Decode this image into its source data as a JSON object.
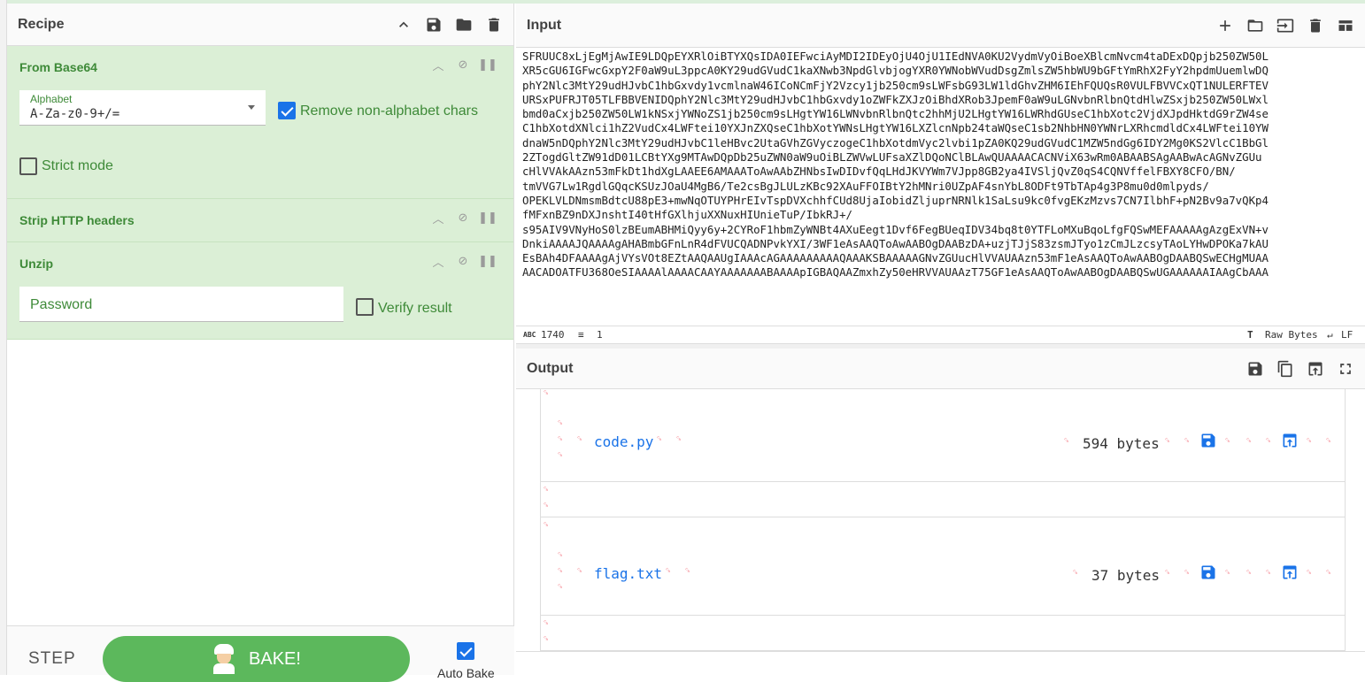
{
  "recipe": {
    "title": "Recipe",
    "operations": [
      {
        "name": "From Base64",
        "alphabet_label": "Alphabet",
        "alphabet_value": "A-Za-z0-9+/=",
        "remove_label": "Remove non-alphabet chars",
        "remove_checked": true,
        "strict_label": "Strict mode",
        "strict_checked": false
      },
      {
        "name": "Strip HTTP headers"
      },
      {
        "name": "Unzip",
        "password_placeholder": "Password",
        "verify_label": "Verify result",
        "verify_checked": false
      }
    ],
    "step_label": "STEP",
    "bake_label": "BAKE!",
    "autobake_label": "Auto Bake",
    "autobake_checked": true
  },
  "input": {
    "title": "Input",
    "lines": [
      "SFRUUC8xLjEgMjAwIE9LDQpEYXRlOiBTYXQsIDA0IEFwciAyMDI2IDEyOjU4OjU1IEdNVA0KU2VydmVyOiBoeXBlcmNvcm4taDExDQpjb250ZW50L",
      "XR5cGU6IGFwcGxpY2F0aW9uL3ppcA0KY29udGVudC1kaXNwb3NpdGlvbjogYXR0YWNobWVudDsgZmlsZW5hbWU9bGFtYmRhX2FyY2hpdmUuemlwDQ",
      "phY2Nlc3MtY29udHJvbC1hbGxvdy1vcmlnaW46ICoNCmFjY2Vzcy1jb250cm9sLWFsbG93LW1ldGhvZHM6IEhFQUQsR0VULFBVVCxQT1NULERFTEV",
      "URSxPUFRJT05TLFBBVENIDQphY2Nlc3MtY29udHJvbC1hbGxvdy1oZWFkZXJzOiBhdXRob3JpemF0aW9uLGNvbnRlbnQtdHlwZSxjb250ZW50LWxl",
      "bmd0aCxjb250ZW50LW1kNSxjYWNoZS1jb250cm9sLHgtYW16LWNvbnRlbnQtc2hhMjU2LHgtYW16LWRhdGUseC1hbXotc2VjdXJpdHktdG9rZW4se",
      "C1hbXotdXNlci1hZ2VudCx4LWFtei10YXJnZXQseC1hbXotYWNsLHgtYW16LXZlcnNpb24taWQseC1sb2NhbHN0YWNrLXRhcmdldCx4LWFtei10YW",
      "dnaW5nDQphY2Nlc3MtY29udHJvbC1leHBvc2UtaGVhZGVyczogeC1hbXotdmVyc2lvbi1pZA0KQ29udGVudC1MZW5ndGg6IDY2Mg0KS2VlcC1BbGl",
      "2ZTogdGltZW91dD01LCBtYXg9MTAwDQpDb25uZWN0aW9uOiBLZWVwLUFsaXZlDQoNClBLAwQUAAAACACNViX63wRm0ABAABSAgAABwAcAGNvZGUu",
      "cHlVVAkAAzn53mFkDt1hdXgLAAEE6AMAAAToAwAAbZHNbsIwDIDvfQqLHdJKVYWm7VJpp8GB2ya4IVSljQvZ0qS4CQNVffelFBXY8CFO/BN/",
      "tmVVG7Lw1RgdlGQqcKSUzJOaU4MgB6/Te2csBgJLULzKBc92XAuFFOIBtY2hMNri0UZpAF4snYbL8ODFt9TbTAp4g3P8mu0d0mlpyds/",
      "OPEKLVLDNmsmBdtcU88pE3+mwNqOTUYPHrEIvTspDVXchhfCUd8UjaIobidZljuprNRNlk1SaLsu9kc0fvgEKzMzvs7CN7IlbhF+pN2Bv9a7vQKp4",
      "fMFxnBZ9nDXJnshtI40tHfGXlhjuXXNuxHIUnieTuP/IbkRJ+/",
      "s95AIV9VNyHoS0lzBEumABHMiQyy6y+2CYRoF1hbmZyWNBt4AXuEegt1Dvf6FegBUeqIDV34bq8t0YTFLoMXuBqoLfgFQSwMEFAAAAAgAzgExVN+v",
      "DnkiAAAAJQAAAAgAHABmbGFnLnR4dFVUCQADNPvkYXI/3WF1eAsAAQToAwAABOgDAABzDA+uzjTJjS83zsmJTyo1zCmJLzcsyTAoLYHwDPOKa7kAU",
      "EsBAh4DFAAAAgAjVYsVOt8EZtAAQAAUgIAAAcAGAAAAAAAAAQAAAKSBAAAAAGNvZGUucHlVVAUAAzn53mF1eAsAAQToAwAABOgDAABQSwECHgMUAA",
      "AACADOATFU368OeSIAAAAlAAAACAAYAAAAAAABAAAApIGBAQAAZmxhZy50eHRVVAUAAzT75GF1eAsAAQToAwAABOgDAABQSwUGAAAAAAIAAgCbAAA"
    ],
    "length_label": "1740",
    "lines_label": "1",
    "encoding_label": "Raw Bytes",
    "eol_label": "LF"
  },
  "output": {
    "title": "Output",
    "files": [
      {
        "name": "code.py",
        "size": "594 bytes"
      },
      {
        "name": "flag.txt",
        "size": "37 bytes"
      }
    ],
    "control_glyph": "␍"
  }
}
